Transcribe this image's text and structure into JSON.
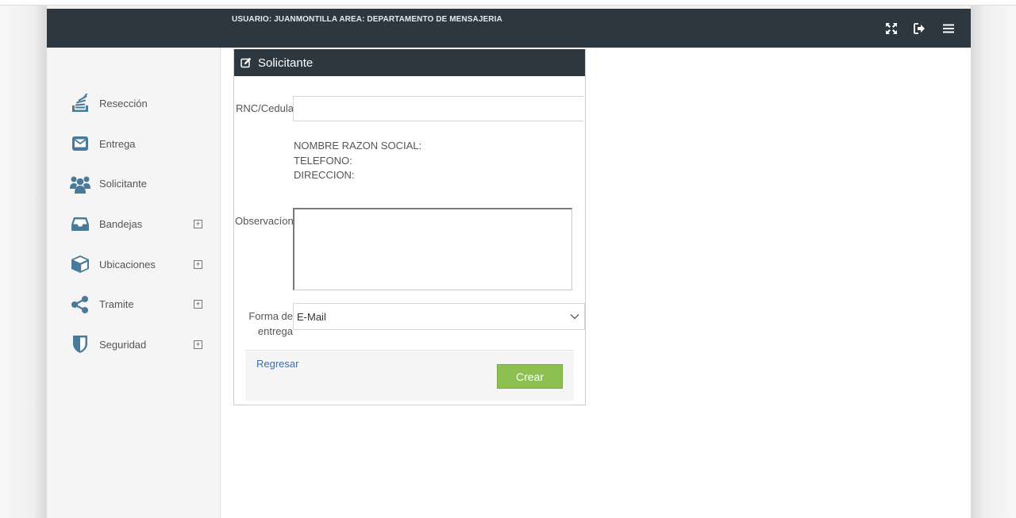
{
  "header": {
    "user_info": "USUARIO: JUANMONTILLA AREA: DEPARTAMENTO DE MENSAJERIA",
    "icons": [
      "fullscreen-icon",
      "logout-icon",
      "menu-icon"
    ]
  },
  "sidebar": {
    "items": [
      {
        "label": "Resección",
        "icon": "stack-icon",
        "expandable": false
      },
      {
        "label": "Entrega",
        "icon": "envelope-icon",
        "expandable": false
      },
      {
        "label": "Solicitante",
        "icon": "users-icon",
        "expandable": false
      },
      {
        "label": "Bandejas",
        "icon": "inbox-icon",
        "expandable": true
      },
      {
        "label": "Ubicaciones",
        "icon": "cube-icon",
        "expandable": true
      },
      {
        "label": "Tramite",
        "icon": "share-icon",
        "expandable": true
      },
      {
        "label": "Seguridad",
        "icon": "shield-icon",
        "expandable": true
      }
    ],
    "expand_symbol": "+"
  },
  "panel": {
    "title": "Solicitante",
    "rnc_label": "RNC/Cedula",
    "rnc_value": "",
    "info": {
      "nombre": "NOMBRE RAZON SOCIAL:",
      "telefono": "TELEFONO:",
      "direccion": "DIRECCION:"
    },
    "observacion_label": "Observacíon",
    "observacion_value": "",
    "forma_label_1": "Forma de",
    "forma_label_2": "entrega",
    "forma_selected": "E-Mail",
    "back_label": "Regresar",
    "create_label": "Crear"
  },
  "colors": {
    "topbar": "#2d3740",
    "icon_blue": "#4a7a99",
    "create_green": "#8cc152",
    "link_blue": "#3a6ea5"
  }
}
